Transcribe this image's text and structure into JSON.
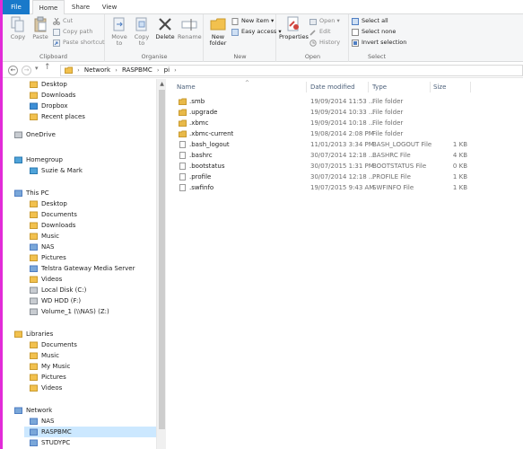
{
  "ribbon": {
    "tabs": [
      "File",
      "Home",
      "Share",
      "View"
    ],
    "clipboard": {
      "title": "Clipboard",
      "copy": "Copy",
      "paste": "Paste",
      "cut": "Cut",
      "copy_path": "Copy path",
      "paste_shortcut": "Paste shortcut"
    },
    "organise": {
      "title": "Organise",
      "move_to": "Move to",
      "copy_to": "Copy to",
      "delete": "Delete",
      "rename": "Rename"
    },
    "new": {
      "title": "New",
      "new_folder": "New folder",
      "new_item": "New item",
      "easy_access": "Easy access"
    },
    "open": {
      "title": "Open",
      "properties": "Properties",
      "open": "Open",
      "edit": "Edit",
      "history": "History"
    },
    "select": {
      "title": "Select",
      "select_all": "Select all",
      "select_none": "Select none",
      "invert_selection": "Invert selection"
    }
  },
  "address": {
    "crumbs": [
      "Network",
      "RASPBMC",
      "pi"
    ]
  },
  "nav": {
    "items": [
      {
        "label": "Desktop",
        "icon": "desktop-icon"
      },
      {
        "label": "Downloads",
        "icon": "downloads-icon"
      },
      {
        "label": "Dropbox",
        "icon": "dropbox-icon"
      },
      {
        "label": "Recent places",
        "icon": "recent-places-icon"
      },
      {
        "label": "OneDrive",
        "icon": "onedrive-icon"
      },
      {
        "label": "Homegroup",
        "icon": "homegroup-icon"
      },
      {
        "label": "Suzie & Mark",
        "icon": "user-icon"
      },
      {
        "label": "This PC",
        "icon": "computer-icon"
      },
      {
        "label": "Desktop",
        "icon": "desktop-icon"
      },
      {
        "label": "Documents",
        "icon": "documents-icon"
      },
      {
        "label": "Downloads",
        "icon": "downloads-icon"
      },
      {
        "label": "Music",
        "icon": "music-icon"
      },
      {
        "label": "NAS",
        "icon": "nas-icon"
      },
      {
        "label": "Pictures",
        "icon": "pictures-icon"
      },
      {
        "label": "Telstra Gateway Media Server",
        "icon": "media-server-icon"
      },
      {
        "label": "Videos",
        "icon": "videos-icon"
      },
      {
        "label": "Local Disk (C:)",
        "icon": "local-disk-icon"
      },
      {
        "label": "WD HDD (F:)",
        "icon": "drive-icon"
      },
      {
        "label": "Volume_1 (\\\\NAS) (Z:)",
        "icon": "network-drive-icon"
      },
      {
        "label": "Libraries",
        "icon": "libraries-icon"
      },
      {
        "label": "Documents",
        "icon": "documents-icon"
      },
      {
        "label": "Music",
        "icon": "music-icon"
      },
      {
        "label": "My Music",
        "icon": "music-icon"
      },
      {
        "label": "Pictures",
        "icon": "pictures-icon"
      },
      {
        "label": "Videos",
        "icon": "videos-icon"
      },
      {
        "label": "Network",
        "icon": "network-icon"
      },
      {
        "label": "NAS",
        "icon": "computer-icon"
      },
      {
        "label": "RASPBMC",
        "icon": "computer-icon"
      },
      {
        "label": "STUDYPC",
        "icon": "computer-icon"
      }
    ]
  },
  "list": {
    "headers": {
      "name": "Name",
      "date": "Date modified",
      "type": "Type",
      "size": "Size"
    },
    "rows": [
      {
        "name": ".smb",
        "date": "19/09/2014 11:53 ...",
        "type": "File folder",
        "size": "",
        "kind": "folder"
      },
      {
        "name": ".upgrade",
        "date": "19/09/2014 10:33 ...",
        "type": "File folder",
        "size": "",
        "kind": "folder"
      },
      {
        "name": ".xbmc",
        "date": "19/09/2014 10:18 ...",
        "type": "File folder",
        "size": "",
        "kind": "folder"
      },
      {
        "name": ".xbmc-current",
        "date": "19/08/2014 2:08 PM",
        "type": "File folder",
        "size": "",
        "kind": "folder"
      },
      {
        "name": ".bash_logout",
        "date": "11/01/2013 3:34 PM",
        "type": "BASH_LOGOUT File",
        "size": "1 KB",
        "kind": "file"
      },
      {
        "name": ".bashrc",
        "date": "30/07/2014 12:18 ...",
        "type": "BASHRC File",
        "size": "4 KB",
        "kind": "file"
      },
      {
        "name": ".bootstatus",
        "date": "30/07/2015 1:31 PM",
        "type": "BOOTSTATUS File",
        "size": "0 KB",
        "kind": "file"
      },
      {
        "name": ".profile",
        "date": "30/07/2014 12:18 ...",
        "type": "PROFILE File",
        "size": "1 KB",
        "kind": "file"
      },
      {
        "name": ".swfinfo",
        "date": "19/07/2015 9:43 AM",
        "type": "SWFINFO File",
        "size": "1 KB",
        "kind": "file"
      }
    ]
  },
  "colors": {
    "file_tab": "#1979ca",
    "selection": "#cce8ff",
    "folder": "#e8b949",
    "accent_pink": "#e22bd8"
  }
}
